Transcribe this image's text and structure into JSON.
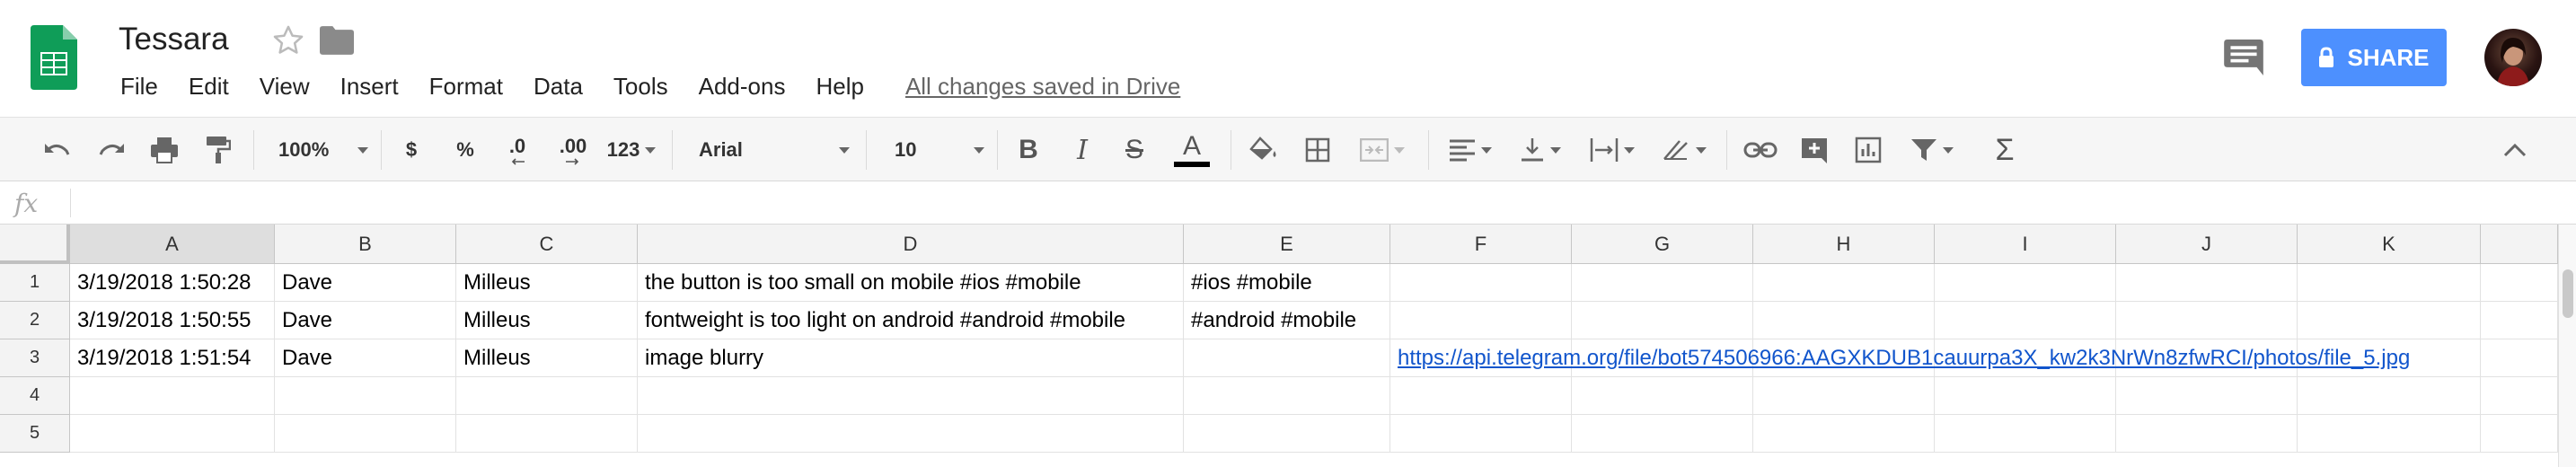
{
  "doc": {
    "title": "Tessara",
    "save_status": "All changes saved in Drive"
  },
  "menu": [
    "File",
    "Edit",
    "View",
    "Insert",
    "Format",
    "Data",
    "Tools",
    "Add-ons",
    "Help"
  ],
  "share": {
    "label": "SHARE"
  },
  "toolbar": {
    "zoom": "100%",
    "currency": "$",
    "percent": "%",
    "decrease_decimal": ".0",
    "increase_decimal": ".00",
    "more_formats": "123",
    "font": "Arial",
    "font_size": "10",
    "bold": "B",
    "italic": "I",
    "strike": "S",
    "text_color": "A",
    "functions": "Σ"
  },
  "formula": {
    "fx": "fx",
    "value": ""
  },
  "colors": {
    "share_blue": "#4d90fe",
    "link_blue": "#1155cc",
    "sheets_green": "#0f9d58"
  },
  "sheet": {
    "columns": [
      "A",
      "B",
      "C",
      "D",
      "E",
      "F",
      "G",
      "H",
      "I",
      "J",
      "K"
    ],
    "selected_column": "A",
    "rows": [
      {
        "num": "1",
        "cells": [
          "3/19/2018 1:50:28",
          "Dave",
          "Milleus",
          "the button is too small on mobile #ios #mobile",
          "#ios #mobile",
          "",
          "",
          "",
          "",
          "",
          ""
        ]
      },
      {
        "num": "2",
        "cells": [
          "3/19/2018 1:50:55",
          "Dave",
          "Milleus",
          "fontweight is too light on android #android #mobile",
          "#android #mobile",
          "",
          "",
          "",
          "",
          "",
          ""
        ]
      },
      {
        "num": "3",
        "cells": [
          "3/19/2018 1:51:54",
          "Dave",
          "Milleus",
          "image blurry",
          "",
          "https://api.telegram.org/file/bot574506966:AAGXKDUB1cauurpa3X_kw2k3NrWn8zfwRCI/photos/file_5.jpg",
          "",
          "",
          "",
          "",
          ""
        ]
      },
      {
        "num": "4",
        "cells": [
          "",
          "",
          "",
          "",
          "",
          "",
          "",
          "",
          "",
          "",
          ""
        ]
      },
      {
        "num": "5",
        "cells": [
          "",
          "",
          "",
          "",
          "",
          "",
          "",
          "",
          "",
          "",
          ""
        ]
      }
    ]
  }
}
